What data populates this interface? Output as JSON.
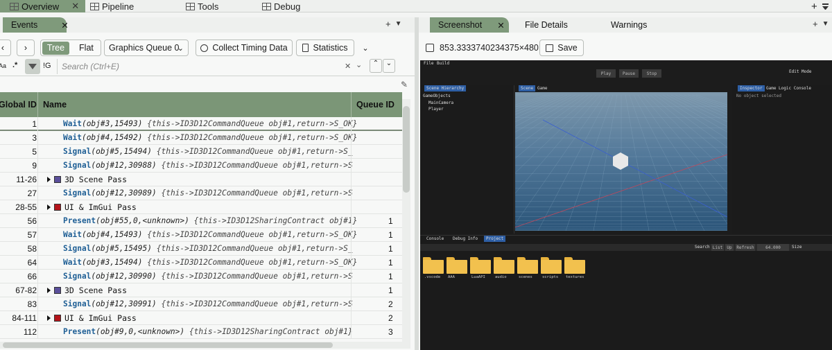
{
  "top_tabs": [
    {
      "label": "Overview",
      "icon": "window-icon"
    },
    {
      "label": "Pipeline",
      "icon": "window-icon"
    },
    {
      "label": "Tools",
      "icon": "window-icon"
    },
    {
      "label": "Debug",
      "icon": "window-icon"
    }
  ],
  "top_close": "✕",
  "top_add": "+",
  "left_panel": {
    "tab": "Events",
    "tab_close": "✕",
    "toolbar": {
      "back": "‹",
      "forward": "›",
      "tree": "Tree",
      "flat": "Flat",
      "queue_select": "Graphics Queue 0",
      "collect_timing": "Collect Timing Data",
      "statistics": "Statistics"
    },
    "search": {
      "case_label": "Aa",
      "regex_label": ".*",
      "ig_label": "!G",
      "placeholder": "Search (Ctrl+E)",
      "clear": "✕"
    },
    "columns": {
      "global_id": "Global ID",
      "name": "Name",
      "queue_id": "Queue ID"
    },
    "rows": [
      {
        "id": "1",
        "kind": "call",
        "fn": "Wait",
        "args": "(obj#3,15493)",
        "note": "{this->ID3D12CommandQueue obj#1,return->S_OK}",
        "q": ""
      },
      {
        "id": "3",
        "kind": "call",
        "fn": "Wait",
        "args": "(obj#4,15492)",
        "note": "{this->ID3D12CommandQueue obj#1,return->S_OK}",
        "q": ""
      },
      {
        "id": "5",
        "kind": "call",
        "fn": "Signal",
        "args": "(obj#5,15494)",
        "note": "{this->ID3D12CommandQueue obj#1,return->S_",
        "q": ""
      },
      {
        "id": "9",
        "kind": "call",
        "fn": "Signal",
        "args": "(obj#12,30988)",
        "note": "{this->ID3D12CommandQueue obj#1,return->S",
        "q": ""
      },
      {
        "id": "11-26",
        "kind": "group",
        "label": "3D Scene Pass",
        "color": "#5a4f9a",
        "q": ""
      },
      {
        "id": "27",
        "kind": "call",
        "fn": "Signal",
        "args": "(obj#12,30989)",
        "note": "{this->ID3D12CommandQueue obj#1,return->S",
        "q": ""
      },
      {
        "id": "28-55",
        "kind": "group",
        "label": "UI & ImGui Pass",
        "color": "#b5141a",
        "q": ""
      },
      {
        "id": "56",
        "kind": "call",
        "fn": "Present",
        "args": "(obj#55,0,<unknown>)",
        "note": "{this->ID3D12SharingContract obj#1}",
        "q": "1"
      },
      {
        "id": "57",
        "kind": "call",
        "fn": "Wait",
        "args": "(obj#4,15493)",
        "note": "{this->ID3D12CommandQueue obj#1,return->S_OK}",
        "q": "1"
      },
      {
        "id": "58",
        "kind": "call",
        "fn": "Signal",
        "args": "(obj#5,15495)",
        "note": "{this->ID3D12CommandQueue obj#1,return->S_",
        "q": "1"
      },
      {
        "id": "64",
        "kind": "call",
        "fn": "Wait",
        "args": "(obj#3,15494)",
        "note": "{this->ID3D12CommandQueue obj#1,return->S_OK}",
        "q": "1"
      },
      {
        "id": "66",
        "kind": "call",
        "fn": "Signal",
        "args": "(obj#12,30990)",
        "note": "{this->ID3D12CommandQueue obj#1,return->S",
        "q": "1"
      },
      {
        "id": "67-82",
        "kind": "group",
        "label": "3D Scene Pass",
        "color": "#5a4f9a",
        "q": "1"
      },
      {
        "id": "83",
        "kind": "call",
        "fn": "Signal",
        "args": "(obj#12,30991)",
        "note": "{this->ID3D12CommandQueue obj#1,return->S",
        "q": "2"
      },
      {
        "id": "84-111",
        "kind": "group",
        "label": "UI & ImGui Pass",
        "color": "#b5141a",
        "q": "2"
      },
      {
        "id": "112",
        "kind": "call",
        "fn": "Present",
        "args": "(obj#9,0,<unknown>)",
        "note": "{this->ID3D12SharingContract obj#1}",
        "q": "3"
      }
    ]
  },
  "right_panel": {
    "tabs": [
      "Screenshot",
      "File Details",
      "Warnings"
    ],
    "tab_close": "✕",
    "resolution": "853.3333740234375×480",
    "save": "Save",
    "game": {
      "menu": [
        "File",
        "Build"
      ],
      "edit_mode": "Edit Mode",
      "play": "Play",
      "pause": "Pause",
      "stop": "Stop",
      "hierarchy_tab": "Scene Hierarchy",
      "hierarchy_root": "GameObjects",
      "hierarchy_items": [
        "MainCamera",
        "Player"
      ],
      "scene_tab": "Scene",
      "game_tab": "Game",
      "inspector_tab": "Inspector",
      "logic_tab": "Game Logic Console",
      "no_object": "No object selected",
      "bottom_tabs": [
        "Console",
        "Debug Info",
        "Project"
      ],
      "search": "Search",
      "list": "List",
      "up": "Up",
      "refresh": "Refresh",
      "size_value": "64.000",
      "size_label": "Size",
      "folders": [
        ".vscode",
        "AAA",
        "LuaAPI",
        "audio",
        "scenes",
        "scripts",
        "textures"
      ]
    }
  }
}
